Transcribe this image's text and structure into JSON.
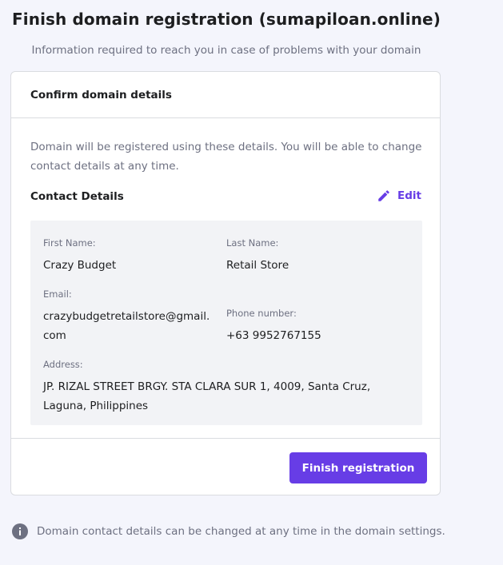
{
  "header": {
    "title": "Finish domain registration (sumapiloan.online)",
    "subtitle": "Information required to reach you in case of problems with your domain"
  },
  "card": {
    "title": "Confirm domain details",
    "description": "Domain will be registered using these details. You will be able to change contact details at any time.",
    "contact_title": "Contact Details",
    "edit_label": "Edit",
    "fields": {
      "first_name_label": "First Name:",
      "first_name": "Crazy Budget",
      "last_name_label": "Last Name:",
      "last_name": "Retail Store",
      "email_label": "Email:",
      "email": "crazybudgetretailstore@gmail.com",
      "phone_label": "Phone number:",
      "phone": "+63 9952767155",
      "address_label": "Address:",
      "address": "JP. RIZAL STREET BRGY. STA CLARA SUR 1, 4009, Santa Cruz, Laguna, Philippines"
    },
    "finish_button_label": "Finish registration"
  },
  "footer_note": "Domain contact details can be changed at any time in the domain settings.",
  "colors": {
    "accent": "#673de6",
    "background": "#f4f5fc",
    "details_panel": "#f2f3f6"
  },
  "icons": {
    "edit": "pencil-icon",
    "info": "info-icon"
  }
}
